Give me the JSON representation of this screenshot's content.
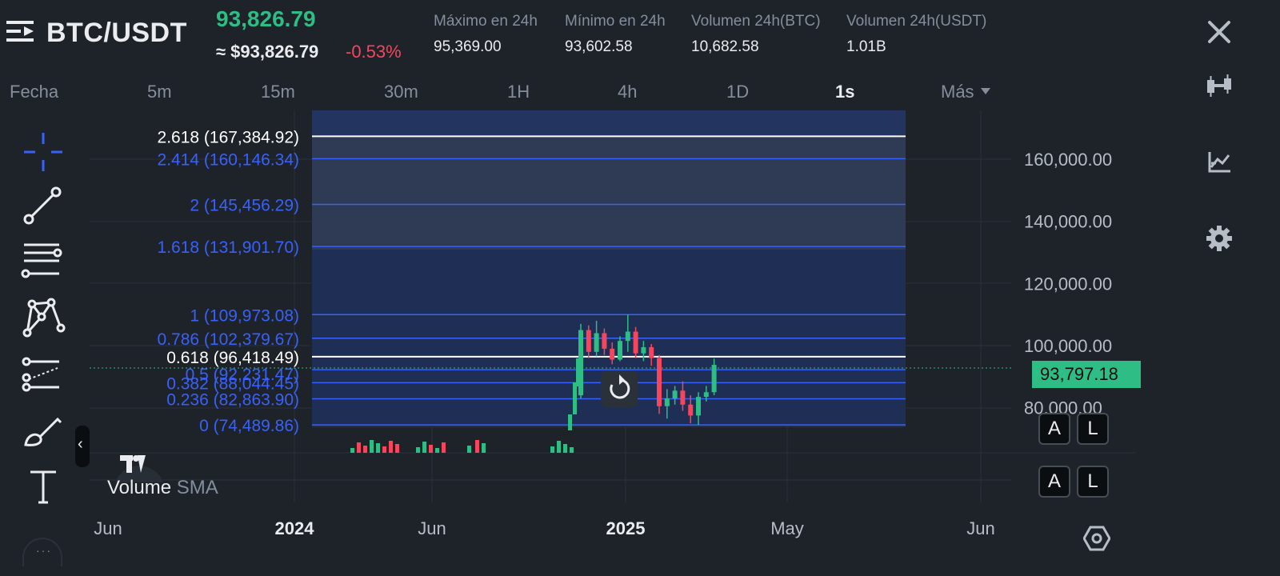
{
  "header": {
    "pair": "BTC/USDT",
    "last_price": "93,826.79",
    "fiat_price": "≈ $93,826.79",
    "change_pct": "-0.53%",
    "stats": [
      {
        "label": "Máximo en 24h",
        "value": "95,369.00"
      },
      {
        "label": "Mínimo en 24h",
        "value": "93,602.58"
      },
      {
        "label": "Volumen 24h(BTC)",
        "value": "10,682.58"
      },
      {
        "label": "Volumen 24h(USDT)",
        "value": "1.01B"
      }
    ]
  },
  "intervals": [
    "Fecha",
    "5m",
    "15m",
    "30m",
    "1H",
    "4h",
    "1D",
    "1s"
  ],
  "active_interval": "1s",
  "more_label": "Más",
  "sidebar_icons": [
    "close-icon",
    "candlestick-icon",
    "indicator-icon",
    "gear-icon"
  ],
  "tools": [
    "crosshair-icon",
    "trendline-icon",
    "fib-levels-icon",
    "pattern-icon",
    "prediction-icon",
    "brush-icon",
    "text-icon"
  ],
  "collapse_glyph": "‹",
  "more_tools_glyph": "···",
  "chart_data": {
    "type": "candlestick",
    "interval": "1s",
    "y_ticks": [
      "160,000.00",
      "140,000.00",
      "120,000.00",
      "100,000.00",
      "80,000.00"
    ],
    "y_tick_values": [
      160000,
      140000,
      120000,
      100000,
      80000
    ],
    "x_ticks": [
      {
        "label": "Jun",
        "bold": false
      },
      {
        "label": "2024",
        "bold": true
      },
      {
        "label": "Jun",
        "bold": false
      },
      {
        "label": "2025",
        "bold": true
      },
      {
        "label": "May",
        "bold": false
      },
      {
        "label": "Jun",
        "bold": false
      }
    ],
    "current_price": "93,797.18",
    "fib_levels": [
      {
        "label": "2.618 (167,384.92)",
        "value": 167384.92,
        "color": "#ffffff"
      },
      {
        "label": "2.414 (160,146.34)",
        "value": 160146.34,
        "color": "#3861fb"
      },
      {
        "label": "2 (145,456.29)",
        "value": 145456.29,
        "color": "#3861fb"
      },
      {
        "label": "1.618 (131,901.70)",
        "value": 131901.7,
        "color": "#3861fb"
      },
      {
        "label": "1 (109,973.08)",
        "value": 109973.08,
        "color": "#3861fb"
      },
      {
        "label": "0.786 (102,379.67)",
        "value": 102379.67,
        "color": "#3861fb"
      },
      {
        "label": "0.618 (96,418.49)",
        "value": 96418.49,
        "color": "#ffffff"
      },
      {
        "label": "0.5 (92,231.47)",
        "value": 92231.47,
        "color": "#3861fb"
      },
      {
        "label": "0.382 (88,044.45)",
        "value": 88044.45,
        "color": "#3861fb"
      },
      {
        "label": "0.236 (82,863.90)",
        "value": 82863.9,
        "color": "#3861fb"
      },
      {
        "label": "0 (74,489.86)",
        "value": 74489.86,
        "color": "#3861fb"
      }
    ],
    "candles": [
      {
        "o": 84000,
        "h": 107000,
        "l": 83000,
        "c": 105000
      },
      {
        "o": 105000,
        "h": 106500,
        "l": 96000,
        "c": 98000
      },
      {
        "o": 98000,
        "h": 108000,
        "l": 96500,
        "c": 104000
      },
      {
        "o": 104000,
        "h": 105500,
        "l": 97000,
        "c": 99000
      },
      {
        "o": 99000,
        "h": 101000,
        "l": 94000,
        "c": 95500
      },
      {
        "o": 95500,
        "h": 103000,
        "l": 95000,
        "c": 101500
      },
      {
        "o": 101500,
        "h": 110000,
        "l": 98000,
        "c": 104500
      },
      {
        "o": 104500,
        "h": 106000,
        "l": 96000,
        "c": 97500
      },
      {
        "o": 97500,
        "h": 101500,
        "l": 95000,
        "c": 99500
      },
      {
        "o": 99500,
        "h": 100500,
        "l": 93500,
        "c": 96000
      },
      {
        "o": 96000,
        "h": 97000,
        "l": 78000,
        "c": 80500
      },
      {
        "o": 80500,
        "h": 86000,
        "l": 76500,
        "c": 83000
      },
      {
        "o": 83000,
        "h": 87000,
        "l": 81000,
        "c": 85500
      },
      {
        "o": 85500,
        "h": 88500,
        "l": 79000,
        "c": 81000
      },
      {
        "o": 81000,
        "h": 84000,
        "l": 75000,
        "c": 77500
      },
      {
        "o": 77500,
        "h": 85000,
        "l": 74500,
        "c": 83500
      },
      {
        "o": 83500,
        "h": 87000,
        "l": 82000,
        "c": 85000
      },
      {
        "o": 85000,
        "h": 95800,
        "l": 84000,
        "c": 93800
      }
    ],
    "volume_label": "Volume",
    "volume_sma_label": "SMA"
  },
  "scale_buttons": [
    "A",
    "L"
  ],
  "reset_icon": "reset-icon"
}
